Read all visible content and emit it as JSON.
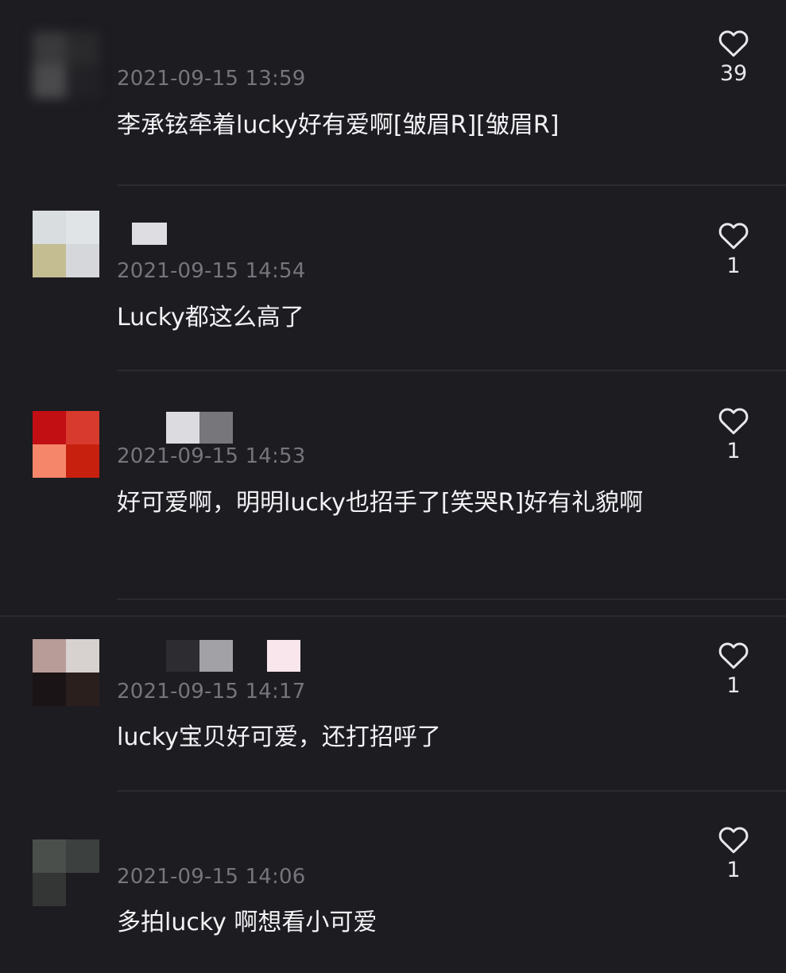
{
  "comments": [
    {
      "timestamp": "2021-09-15 13:59",
      "text": "李承铉牵着lucky好有爱啊[皱眉R][皱眉R]",
      "likes": "39",
      "avatar_colors": [
        "#3a3a3c",
        "#2a2a2c",
        "#4a4a4c",
        "#222226"
      ],
      "name_blocks": []
    },
    {
      "timestamp": "2021-09-15 14:54",
      "text": "Lucky都这么高了",
      "likes": "1",
      "avatar_colors": [
        "#d9dde0",
        "#e1e4e6",
        "#c4bd92",
        "#d6d7da"
      ],
      "name_blocks": [
        "#dedee2"
      ]
    },
    {
      "timestamp": "2021-09-15 14:53",
      "text": "好可爱啊，明明lucky也招手了[笑哭R]好有礼貌啊",
      "likes": "1",
      "avatar_colors": [
        "#c20f14",
        "#d83a2e",
        "#f5866a",
        "#c8200f"
      ],
      "name_blocks": [
        "#dcdce0",
        "#77777b"
      ]
    },
    {
      "timestamp": "2021-09-15 14:17",
      "text": "lucky宝贝好可爱，还打招呼了",
      "likes": "1",
      "avatar_colors": [
        "#b79c97",
        "#d7d2d0",
        "#1b1416",
        "#2b1f1e"
      ],
      "name_blocks": [
        "#2c2c31",
        "#a1a1a6",
        "#f9e6ec"
      ]
    },
    {
      "timestamp": "2021-09-15 14:06",
      "text": "多拍lucky 啊想看小可爱",
      "likes": "1",
      "avatar_colors": [
        "#4a4f4c",
        "#3c403e",
        "#333634",
        "#1c1c21"
      ],
      "name_blocks": []
    }
  ],
  "colors": {
    "background": "#1c1c21",
    "text_primary": "#f2f2f4",
    "text_secondary": "#75757c",
    "divider": "#2a2a30"
  },
  "icons": {
    "like": "heart-outline-icon"
  }
}
